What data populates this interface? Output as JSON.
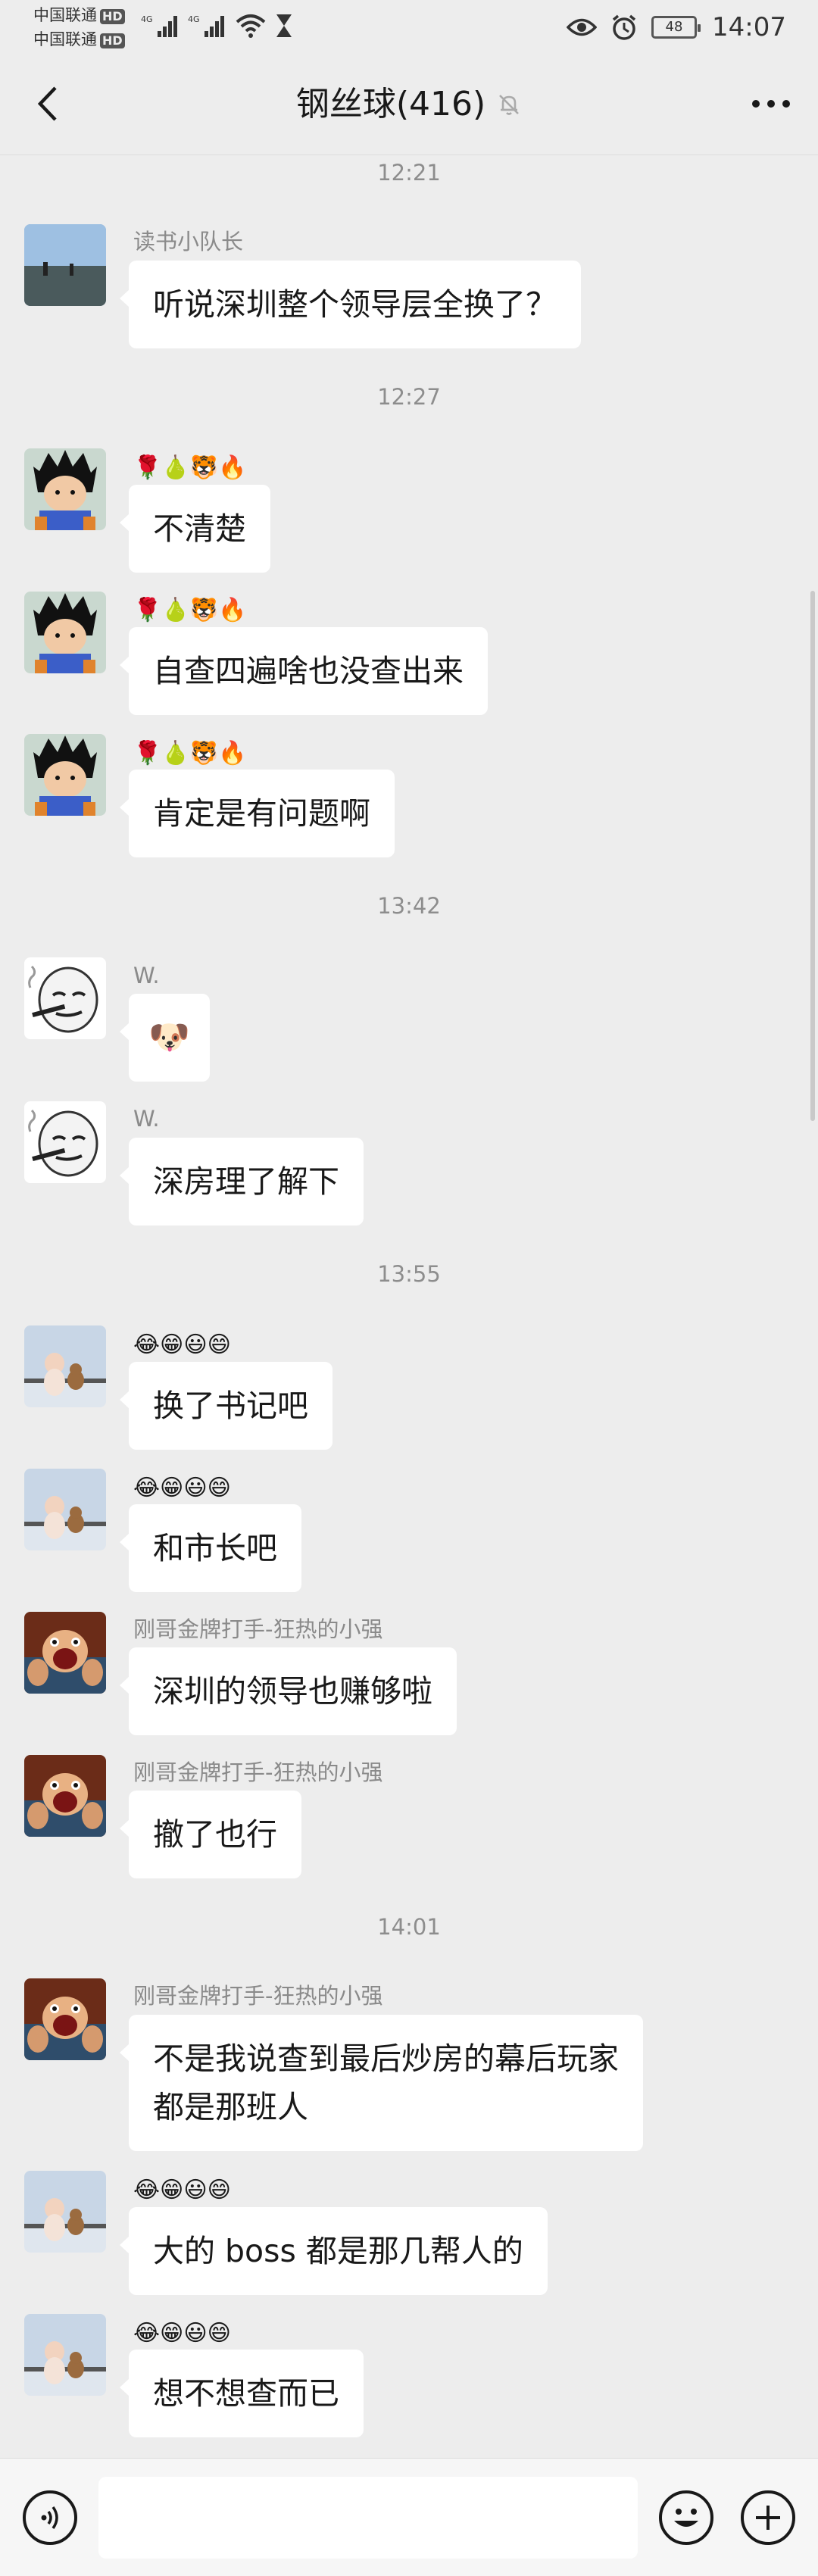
{
  "status_bar": {
    "carrier1": "中国联通",
    "carrier2": "中国联通",
    "hd_badge": "HD",
    "network1": "4G",
    "network2": "4G",
    "battery": "48",
    "time": "14:07"
  },
  "header": {
    "title": "钢丝球(416)"
  },
  "messages": [
    {
      "type": "time",
      "text": "12:21"
    },
    {
      "type": "msg",
      "sender": "读书小队长",
      "text": "听说深圳整个领导层全换了？",
      "avatar": "landscape"
    },
    {
      "type": "time",
      "text": "12:27"
    },
    {
      "type": "msg",
      "sender_emoji": "🌹🍐🐯🔥",
      "text": "不清楚",
      "avatar": "goku"
    },
    {
      "type": "msg",
      "sender_emoji": "🌹🍐🐯🔥",
      "text": "自查四遍啥也没查出来",
      "avatar": "goku"
    },
    {
      "type": "msg",
      "sender_emoji": "🌹🍐🐯🔥",
      "text": "肯定是有问题啊",
      "avatar": "goku"
    },
    {
      "type": "time",
      "text": "13:42"
    },
    {
      "type": "msg",
      "sender": "W.",
      "text": "🐶",
      "avatar": "meme"
    },
    {
      "type": "msg",
      "sender": "W.",
      "text": "深房理了解下",
      "avatar": "meme"
    },
    {
      "type": "time",
      "text": "13:55"
    },
    {
      "type": "msg",
      "sender_emoji": "😂😁😃😄",
      "text": "换了书记吧",
      "avatar": "baby"
    },
    {
      "type": "msg",
      "sender_emoji": "😂😁😃😄",
      "text": "和市长吧",
      "avatar": "baby"
    },
    {
      "type": "msg",
      "sender": "刚哥金牌打手-狂热的小强",
      "text": "深圳的领导也赚够啦",
      "avatar": "cartoon"
    },
    {
      "type": "msg",
      "sender": "刚哥金牌打手-狂热的小强",
      "text": "撤了也行",
      "avatar": "cartoon"
    },
    {
      "type": "time",
      "text": "14:01"
    },
    {
      "type": "msg",
      "sender": "刚哥金牌打手-狂热的小强",
      "text": "不是我说查到最后炒房的幕后玩家",
      "text2": "都是那班人",
      "avatar": "cartoon"
    },
    {
      "type": "msg",
      "sender_emoji": "😂😁😃😄",
      "text": "大的 boss 都是那几帮人的",
      "avatar": "baby"
    },
    {
      "type": "msg",
      "sender_emoji": "😂😁😃😄",
      "text": "想不想查而已",
      "avatar": "baby"
    }
  ],
  "input": {
    "placeholder": ""
  }
}
